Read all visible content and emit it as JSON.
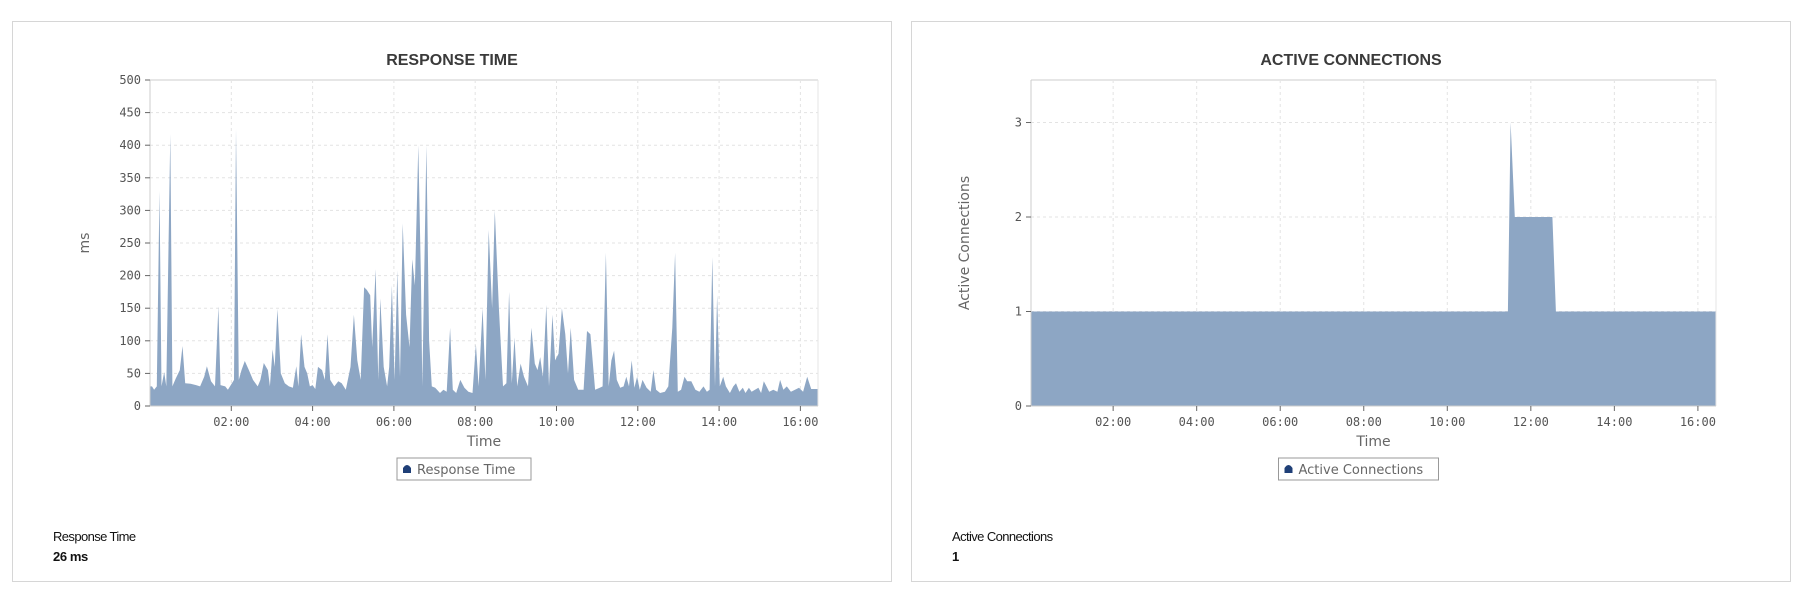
{
  "colors": {
    "fill": "#8da6c4",
    "legend_marker": "#1f3f77",
    "grid": "#e3e3e3",
    "axis": "#cccccc"
  },
  "panels": [
    {
      "summary_label": "Response Time",
      "summary_value": "26 ms"
    },
    {
      "summary_label": "Active Connections",
      "summary_value": "1"
    }
  ],
  "chart_data": [
    {
      "type": "area",
      "title": "RESPONSE TIME",
      "xlabel": "Time",
      "ylabel": "ms",
      "legend": [
        "Response Time"
      ],
      "legend_position": "bottom-center",
      "grid": true,
      "xlim_minutes": [
        0,
        986
      ],
      "ylim": [
        0,
        500
      ],
      "yticks": [
        0,
        50,
        100,
        150,
        200,
        250,
        300,
        350,
        400,
        450,
        500
      ],
      "xticks": [
        "02:00",
        "04:00",
        "06:00",
        "08:00",
        "10:00",
        "12:00",
        "14:00",
        "16:00"
      ],
      "series": [
        {
          "name": "Response Time",
          "points": [
            [
              0,
              30
            ],
            [
              3,
              30
            ],
            [
              6,
              25
            ],
            [
              10,
              30
            ],
            [
              14,
              330
            ],
            [
              17,
              30
            ],
            [
              21,
              52
            ],
            [
              24,
              30
            ],
            [
              30,
              417
            ],
            [
              33,
              30
            ],
            [
              38,
              42
            ],
            [
              44,
              55
            ],
            [
              48,
              92
            ],
            [
              52,
              35
            ],
            [
              60,
              34
            ],
            [
              68,
              32
            ],
            [
              74,
              30
            ],
            [
              80,
              45
            ],
            [
              84,
              61
            ],
            [
              90,
              38
            ],
            [
              96,
              30
            ],
            [
              101,
              153
            ],
            [
              104,
              32
            ],
            [
              111,
              30
            ],
            [
              115,
              25
            ],
            [
              124,
              40
            ],
            [
              127,
              425
            ],
            [
              131,
              40
            ],
            [
              135,
              55
            ],
            [
              140,
              69
            ],
            [
              146,
              55
            ],
            [
              152,
              40
            ],
            [
              159,
              30
            ],
            [
              163,
              40
            ],
            [
              168,
              66
            ],
            [
              174,
              55
            ],
            [
              177,
              30
            ],
            [
              181,
              87
            ],
            [
              184,
              60
            ],
            [
              188,
              149
            ],
            [
              193,
              50
            ],
            [
              199,
              35
            ],
            [
              205,
              30
            ],
            [
              211,
              28
            ],
            [
              216,
              61
            ],
            [
              219,
              30
            ],
            [
              223,
              110
            ],
            [
              228,
              60
            ],
            [
              232,
              50
            ],
            [
              236,
              30
            ],
            [
              240,
              32
            ],
            [
              244,
              26
            ],
            [
              248,
              60
            ],
            [
              254,
              55
            ],
            [
              258,
              40
            ],
            [
              262,
              110
            ],
            [
              266,
              40
            ],
            [
              272,
              30
            ],
            [
              278,
              38
            ],
            [
              283,
              35
            ],
            [
              289,
              25
            ],
            [
              296,
              60
            ],
            [
              301,
              140
            ],
            [
              306,
              70
            ],
            [
              311,
              40
            ],
            [
              316,
              182
            ],
            [
              320,
              178
            ],
            [
              325,
              170
            ],
            [
              328,
              90
            ],
            [
              333,
              210
            ],
            [
              337,
              40
            ],
            [
              340,
              165
            ],
            [
              345,
              60
            ],
            [
              350,
              30
            ],
            [
              353,
              60
            ],
            [
              357,
              185
            ],
            [
              361,
              40
            ],
            [
              365,
              208
            ],
            [
              369,
              45
            ],
            [
              373,
              280
            ],
            [
              378,
              140
            ],
            [
              383,
              90
            ],
            [
              387,
              225
            ],
            [
              391,
              185
            ],
            [
              396,
              400
            ],
            [
              400,
              190
            ],
            [
              402,
              30
            ],
            [
              408,
              400
            ],
            [
              412,
              100
            ],
            [
              416,
              30
            ],
            [
              421,
              28
            ],
            [
              428,
              20
            ],
            [
              433,
              25
            ],
            [
              438,
              22
            ],
            [
              443,
              120
            ],
            [
              447,
              25
            ],
            [
              452,
              20
            ],
            [
              458,
              40
            ],
            [
              464,
              28
            ],
            [
              470,
              22
            ],
            [
              476,
              20
            ],
            [
              481,
              95
            ],
            [
              485,
              30
            ],
            [
              491,
              150
            ],
            [
              495,
              40
            ],
            [
              500,
              270
            ],
            [
              505,
              150
            ],
            [
              509,
              300
            ],
            [
              515,
              150
            ],
            [
              521,
              30
            ],
            [
              526,
              35
            ],
            [
              530,
              175
            ],
            [
              534,
              35
            ],
            [
              538,
              105
            ],
            [
              542,
              30
            ],
            [
              547,
              65
            ],
            [
              552,
              45
            ],
            [
              558,
              30
            ],
            [
              563,
              120
            ],
            [
              568,
              65
            ],
            [
              572,
              55
            ],
            [
              576,
              75
            ],
            [
              580,
              45
            ],
            [
              585,
              155
            ],
            [
              589,
              30
            ],
            [
              594,
              140
            ],
            [
              598,
              70
            ],
            [
              603,
              80
            ],
            [
              608,
              150
            ],
            [
              613,
              110
            ],
            [
              617,
              50
            ],
            [
              621,
              120
            ],
            [
              626,
              40
            ],
            [
              632,
              25
            ],
            [
              640,
              25
            ],
            [
              645,
              115
            ],
            [
              650,
              110
            ],
            [
              657,
              25
            ],
            [
              664,
              28
            ],
            [
              668,
              30
            ],
            [
              673,
              235
            ],
            [
              677,
              30
            ],
            [
              681,
              70
            ],
            [
              685,
              85
            ],
            [
              689,
              40
            ],
            [
              694,
              28
            ],
            [
              699,
              30
            ],
            [
              703,
              45
            ],
            [
              707,
              30
            ],
            [
              711,
              70
            ],
            [
              715,
              28
            ],
            [
              719,
              45
            ],
            [
              723,
              25
            ],
            [
              727,
              40
            ],
            [
              733,
              28
            ],
            [
              739,
              22
            ],
            [
              743,
              55
            ],
            [
              747,
              25
            ],
            [
              753,
              20
            ],
            [
              760,
              22
            ],
            [
              765,
              30
            ],
            [
              771,
              120
            ],
            [
              775,
              235
            ],
            [
              779,
              22
            ],
            [
              784,
              25
            ],
            [
              789,
              45
            ],
            [
              793,
              38
            ],
            [
              799,
              38
            ],
            [
              805,
              25
            ],
            [
              811,
              22
            ],
            [
              817,
              30
            ],
            [
              822,
              22
            ],
            [
              826,
              25
            ],
            [
              830,
              228
            ],
            [
              834,
              30
            ],
            [
              837,
              170
            ],
            [
              841,
              30
            ],
            [
              846,
              45
            ],
            [
              850,
              30
            ],
            [
              856,
              20
            ],
            [
              861,
              30
            ],
            [
              865,
              35
            ],
            [
              870,
              22
            ],
            [
              875,
              28
            ],
            [
              879,
              20
            ],
            [
              884,
              28
            ],
            [
              888,
              22
            ],
            [
              893,
              25
            ],
            [
              898,
              28
            ],
            [
              902,
              20
            ],
            [
              906,
              38
            ],
            [
              910,
              30
            ],
            [
              914,
              22
            ],
            [
              920,
              25
            ],
            [
              926,
              22
            ],
            [
              930,
              40
            ],
            [
              935,
              25
            ],
            [
              940,
              30
            ],
            [
              946,
              22
            ],
            [
              952,
              25
            ],
            [
              958,
              28
            ],
            [
              964,
              22
            ],
            [
              970,
              45
            ],
            [
              976,
              26
            ],
            [
              986,
              26
            ]
          ]
        }
      ]
    },
    {
      "type": "area",
      "title": "ACTIVE CONNECTIONS",
      "xlabel": "Time",
      "ylabel": "Active Connections",
      "legend": [
        "Active Connections"
      ],
      "legend_position": "bottom-center",
      "grid": true,
      "xlim_minutes": [
        2,
        986
      ],
      "ylim": [
        0,
        3.45
      ],
      "yticks": [
        0,
        1,
        2,
        3
      ],
      "xticks": [
        "02:00",
        "04:00",
        "06:00",
        "08:00",
        "10:00",
        "12:00",
        "14:00",
        "16:00"
      ],
      "series": [
        {
          "name": "Active Connections",
          "points": [
            [
              2,
              1
            ],
            [
              687,
              1
            ],
            [
              691,
              3
            ],
            [
              697,
              2
            ],
            [
              751,
              2
            ],
            [
              756,
              1
            ],
            [
              986,
              1
            ]
          ]
        }
      ]
    }
  ]
}
